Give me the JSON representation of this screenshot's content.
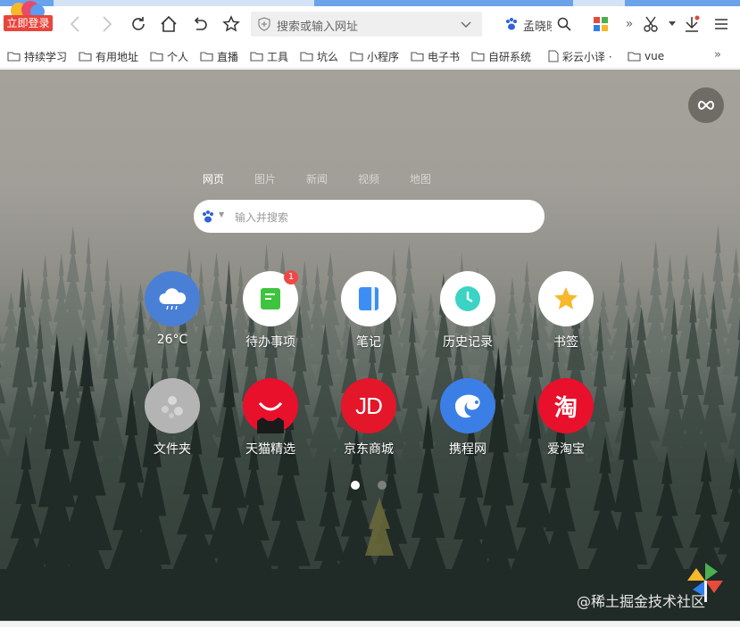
{
  "toolbar": {
    "login_label": "立即登录",
    "url_placeholder": "搜索或输入网址",
    "user_name": "孟晓晓"
  },
  "bookmarks": [
    {
      "label": "持续学习",
      "icon": "folder-icon"
    },
    {
      "label": "有用地址",
      "icon": "folder-icon"
    },
    {
      "label": "个人",
      "icon": "folder-icon"
    },
    {
      "label": "直播",
      "icon": "folder-icon"
    },
    {
      "label": "工具",
      "icon": "folder-icon"
    },
    {
      "label": "坑么",
      "icon": "folder-icon"
    },
    {
      "label": "小程序",
      "icon": "folder-icon"
    },
    {
      "label": "电子书",
      "icon": "folder-icon"
    },
    {
      "label": "自研系统",
      "icon": "folder-icon"
    },
    {
      "label": "彩云小译 ·",
      "icon": "page-icon"
    },
    {
      "label": "vue",
      "icon": "folder-icon"
    }
  ],
  "bookmarks_more": "»",
  "newtab": {
    "search_tabs": [
      "网页",
      "图片",
      "新闻",
      "视频",
      "地图"
    ],
    "search_placeholder": "输入并搜索",
    "tiles": [
      {
        "label": "26°C",
        "icon": "weather-cloud-icon",
        "color": "#4a7fd6"
      },
      {
        "label": "待办事项",
        "icon": "todo-icon",
        "color": "#ffffff",
        "badge": "1"
      },
      {
        "label": "笔记",
        "icon": "note-icon",
        "color": "#ffffff"
      },
      {
        "label": "历史记录",
        "icon": "clock-icon",
        "color": "#ffffff"
      },
      {
        "label": "书签",
        "icon": "star-icon",
        "color": "#ffffff"
      },
      {
        "label": "文件夹",
        "icon": "folder-grey-icon",
        "color": "#b4b4b4"
      },
      {
        "label": "天猫精选",
        "icon": "tmall-icon",
        "color": "#e8102b"
      },
      {
        "label": "京东商城",
        "icon": "jd-icon",
        "color": "#e4162a",
        "logo_text": "JD"
      },
      {
        "label": "携程网",
        "icon": "ctrip-icon",
        "color": "#3b7fe6"
      },
      {
        "label": "爱淘宝",
        "icon": "taobao-icon",
        "color": "#e8102b",
        "logo_text": "淘"
      }
    ],
    "watermark": "@稀土掘金技术社区"
  }
}
